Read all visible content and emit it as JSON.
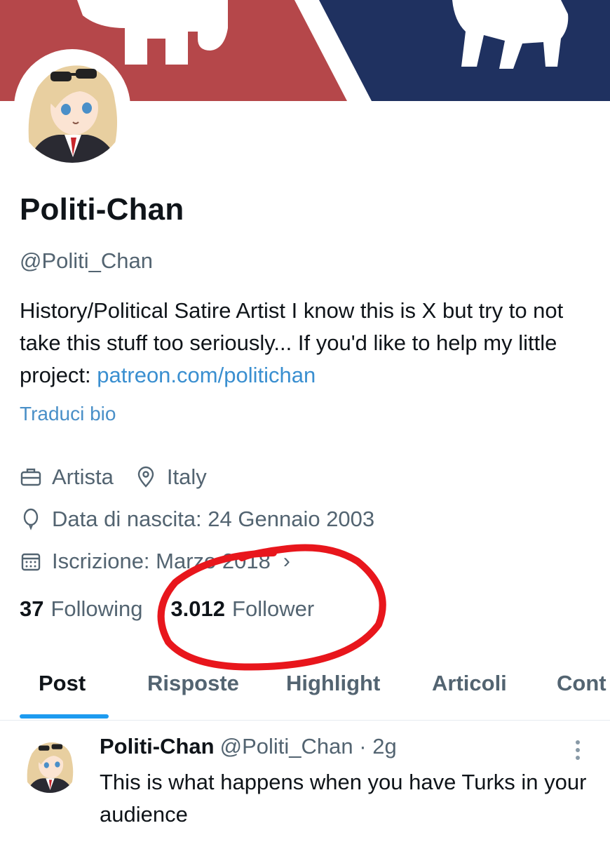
{
  "profile": {
    "name": "Politi-Chan",
    "handle": "@Politi_Chan",
    "bio_text": "History/Political Satire Artist I know this is X but try to not take this stuff too seriously... If you'd like to help my little project: ",
    "bio_link": "patreon.com/politichan",
    "translate_label": "Traduci bio",
    "profession": "Artista",
    "location": "Italy",
    "birth_date": "Data di nascita: 24 Gennaio 2003",
    "joined": "Iscrizione: Marzo 2018",
    "following_count": "37",
    "following_label": "Following",
    "followers_count": "3.012",
    "followers_label": "Follower"
  },
  "tabs": [
    {
      "label": "Post",
      "active": true
    },
    {
      "label": "Risposte",
      "active": false
    },
    {
      "label": "Highlight",
      "active": false
    },
    {
      "label": "Articoli",
      "active": false
    },
    {
      "label": "Cont",
      "active": false
    }
  ],
  "post": {
    "author_name": "Politi-Chan",
    "author_handle": "@Politi_Chan",
    "separator": "·",
    "time": "2g",
    "text": "This is what happens when you have Turks in your audience"
  },
  "colors": {
    "banner_red": "#b5474a",
    "banner_navy": "#1f3160",
    "link_blue": "#1d9bf0",
    "annotation_red": "#e8161c"
  },
  "icons": {
    "profession": "briefcase-icon",
    "location": "location-pin-icon",
    "birth": "balloon-icon",
    "joined": "calendar-icon",
    "more": "more-vertical-icon"
  }
}
